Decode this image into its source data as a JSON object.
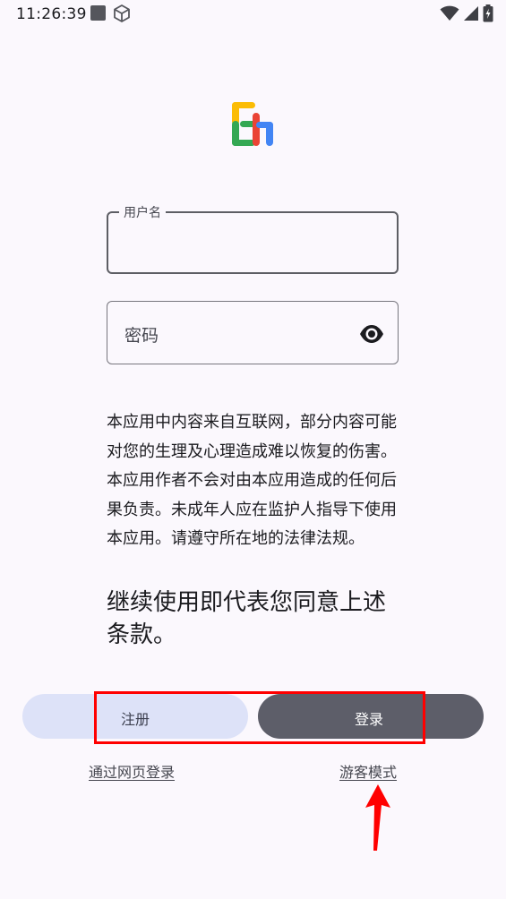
{
  "status_bar": {
    "time": "11:26:39",
    "icons": [
      "stop-square-icon",
      "cube-icon",
      "wifi-icon",
      "signal-icon",
      "battery-charging-icon"
    ]
  },
  "app": {
    "logo_icon": "eh-logo-icon",
    "logo_colors": [
      "#fbbc05",
      "#34a853",
      "#ea4335",
      "#4285f4"
    ]
  },
  "form": {
    "username": {
      "label": "用户名",
      "value": ""
    },
    "password": {
      "placeholder": "密码",
      "toggle_icon": "eye-icon"
    }
  },
  "disclaimer": "本应用中内容来自互联网，部分内容可能对您的生理及心理造成难以恢复的伤害。本应用作者不会对由本应用造成的任何后果负责。未成年人应在监护人指导下使用本应用。请遵守所在地的法律法规。",
  "agreement": "继续使用即代表您同意上述条款。",
  "buttons": {
    "register": "注册",
    "login": "登录"
  },
  "links": {
    "web_login": "通过网页登录",
    "guest_mode": "游客模式"
  },
  "annotations": {
    "highlight_color": "#ff0000",
    "arrow_color": "#ff0000"
  }
}
